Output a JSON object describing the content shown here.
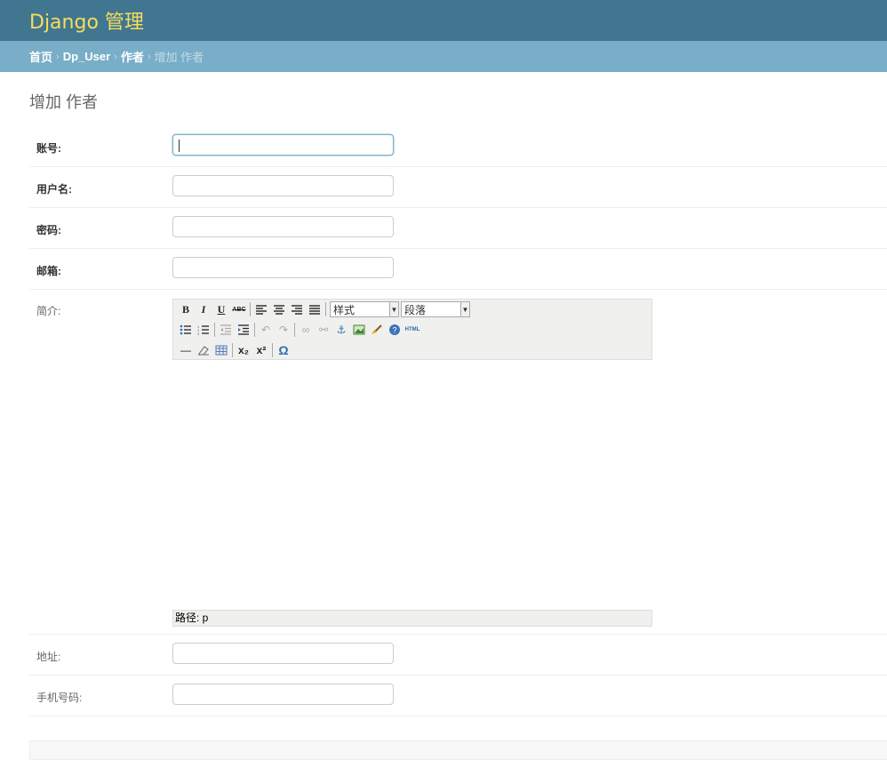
{
  "header": {
    "title": "Django 管理"
  },
  "breadcrumbs": {
    "home": "首页",
    "app": "Dp_User",
    "model": "作者",
    "current": "增加 作者",
    "separator": "›"
  },
  "page": {
    "title": "增加 作者"
  },
  "fields": {
    "account": {
      "label": "账号:",
      "value": ""
    },
    "username": {
      "label": "用户名:",
      "value": ""
    },
    "password": {
      "label": "密码:",
      "value": ""
    },
    "email": {
      "label": "邮箱:",
      "value": ""
    },
    "intro": {
      "label": "简介:"
    },
    "address": {
      "label": "地址:",
      "value": ""
    },
    "phone": {
      "label": "手机号码:",
      "value": ""
    }
  },
  "editor": {
    "style_select": "样式",
    "format_select": "段落",
    "status_path": "路径: p",
    "toolbar_glyphs": {
      "bold": "B",
      "italic": "I",
      "underline": "U",
      "strike": "ABC",
      "subscript": "x₂",
      "superscript": "x²",
      "special_char": "Ω",
      "html": "HTML"
    }
  }
}
